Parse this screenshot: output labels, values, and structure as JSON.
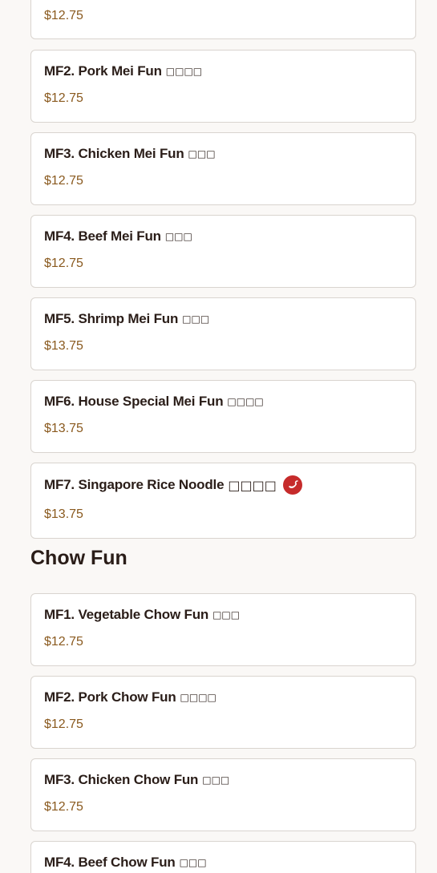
{
  "top_partial": {
    "price": "$12.75"
  },
  "mei_fun": {
    "items": [
      {
        "name": "MF2. Pork Mei Fun",
        "cjk": "□□□□",
        "price": "$12.75"
      },
      {
        "name": "MF3. Chicken Mei Fun",
        "cjk": "□□□",
        "price": "$12.75"
      },
      {
        "name": "MF4. Beef Mei Fun",
        "cjk": "□□□",
        "price": "$12.75"
      },
      {
        "name": "MF5. Shrimp Mei Fun",
        "cjk": "□□□",
        "price": "$13.75"
      },
      {
        "name": "MF6. House Special Mei Fun",
        "cjk": "□□□□",
        "price": "$13.75"
      },
      {
        "name": "MF7. Singapore Rice Noodle",
        "cjk": "□□□□",
        "price": "$13.75",
        "icon": "spicy-chili-icon"
      }
    ]
  },
  "chow_fun": {
    "title": "Chow Fun",
    "items": [
      {
        "name": "MF1. Vegetable Chow Fun",
        "cjk": "□□□",
        "price": "$12.75"
      },
      {
        "name": "MF2. Pork Chow Fun",
        "cjk": "□□□□",
        "price": "$12.75"
      },
      {
        "name": "MF3. Chicken Chow Fun",
        "cjk": "□□□",
        "price": "$12.75"
      },
      {
        "name": "MF4. Beef Chow Fun",
        "cjk": "□□□"
      }
    ]
  },
  "colors": {
    "background": "#faf8f6",
    "card_border": "#d9d4cf",
    "text": "#2a1d18",
    "price": "#8a5a1f",
    "spicy": "#c62b2b"
  }
}
